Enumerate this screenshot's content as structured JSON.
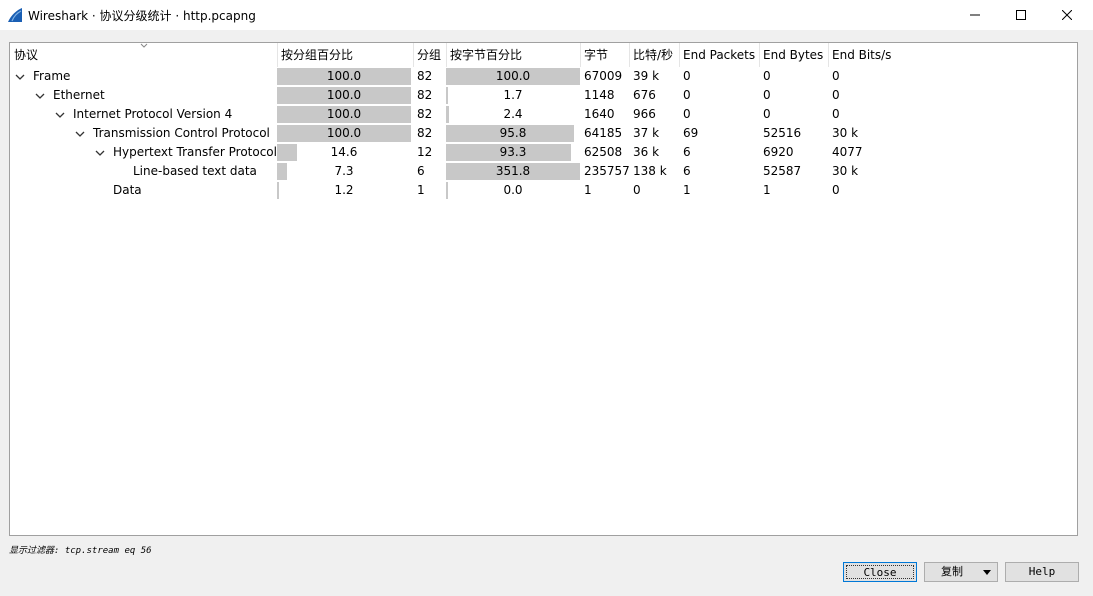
{
  "window": {
    "title": "Wireshark · 协议分级统计 · http.pcapng",
    "icon": "wireshark-fin-icon"
  },
  "columns": [
    "协议",
    "按分组百分比",
    "分组",
    "按字节百分比",
    "字节",
    "比特/秒",
    "End Packets",
    "End Bytes",
    "End Bits/s"
  ],
  "rows": [
    {
      "depth": 0,
      "expanded": true,
      "has_children": true,
      "protocol": "Frame",
      "pkt_pct": "100.0",
      "pkt_frac": 1.0,
      "packets": "82",
      "byte_pct": "100.0",
      "byte_frac": 1.0,
      "bytes": "67009",
      "bits_s": "39 k",
      "end_packets": "0",
      "end_bytes": "0",
      "end_bits_s": "0"
    },
    {
      "depth": 1,
      "expanded": true,
      "has_children": true,
      "protocol": "Ethernet",
      "pkt_pct": "100.0",
      "pkt_frac": 1.0,
      "packets": "82",
      "byte_pct": "1.7",
      "byte_frac": 0.017,
      "bytes": "1148",
      "bits_s": "676",
      "end_packets": "0",
      "end_bytes": "0",
      "end_bits_s": "0"
    },
    {
      "depth": 2,
      "expanded": true,
      "has_children": true,
      "protocol": "Internet Protocol Version 4",
      "pkt_pct": "100.0",
      "pkt_frac": 1.0,
      "packets": "82",
      "byte_pct": "2.4",
      "byte_frac": 0.024,
      "bytes": "1640",
      "bits_s": "966",
      "end_packets": "0",
      "end_bytes": "0",
      "end_bits_s": "0"
    },
    {
      "depth": 3,
      "expanded": true,
      "has_children": true,
      "protocol": "Transmission Control Protocol",
      "pkt_pct": "100.0",
      "pkt_frac": 1.0,
      "packets": "82",
      "byte_pct": "95.8",
      "byte_frac": 0.958,
      "bytes": "64185",
      "bits_s": "37 k",
      "end_packets": "69",
      "end_bytes": "52516",
      "end_bits_s": "30 k"
    },
    {
      "depth": 4,
      "expanded": true,
      "has_children": true,
      "protocol": "Hypertext Transfer Protocol",
      "pkt_pct": "14.6",
      "pkt_frac": 0.146,
      "packets": "12",
      "byte_pct": "93.3",
      "byte_frac": 0.933,
      "bytes": "62508",
      "bits_s": "36 k",
      "end_packets": "6",
      "end_bytes": "6920",
      "end_bits_s": "4077"
    },
    {
      "depth": 5,
      "expanded": false,
      "has_children": false,
      "protocol": "Line-based text data",
      "pkt_pct": "7.3",
      "pkt_frac": 0.073,
      "packets": "6",
      "byte_pct": "351.8",
      "byte_frac": 1.0,
      "bytes": "235757",
      "bits_s": "138 k",
      "end_packets": "6",
      "end_bytes": "52587",
      "end_bits_s": "30 k"
    },
    {
      "depth": 4,
      "expanded": false,
      "has_children": false,
      "protocol": "Data",
      "pkt_pct": "1.2",
      "pkt_frac": 0.012,
      "packets": "1",
      "byte_pct": "0.0",
      "byte_frac": 0.0,
      "bytes": "1",
      "bits_s": "0",
      "end_packets": "1",
      "end_bytes": "1",
      "end_bits_s": "0"
    }
  ],
  "footer": {
    "filter_text": "显示过滤器: tcp.stream eq 56"
  },
  "buttons": {
    "close": "Close",
    "copy": "复制",
    "help": "Help"
  },
  "colors": {
    "bar_fill": "#c8c8c8",
    "focus_border": "#0078d7",
    "icon_blue": "#1a5fb4"
  }
}
